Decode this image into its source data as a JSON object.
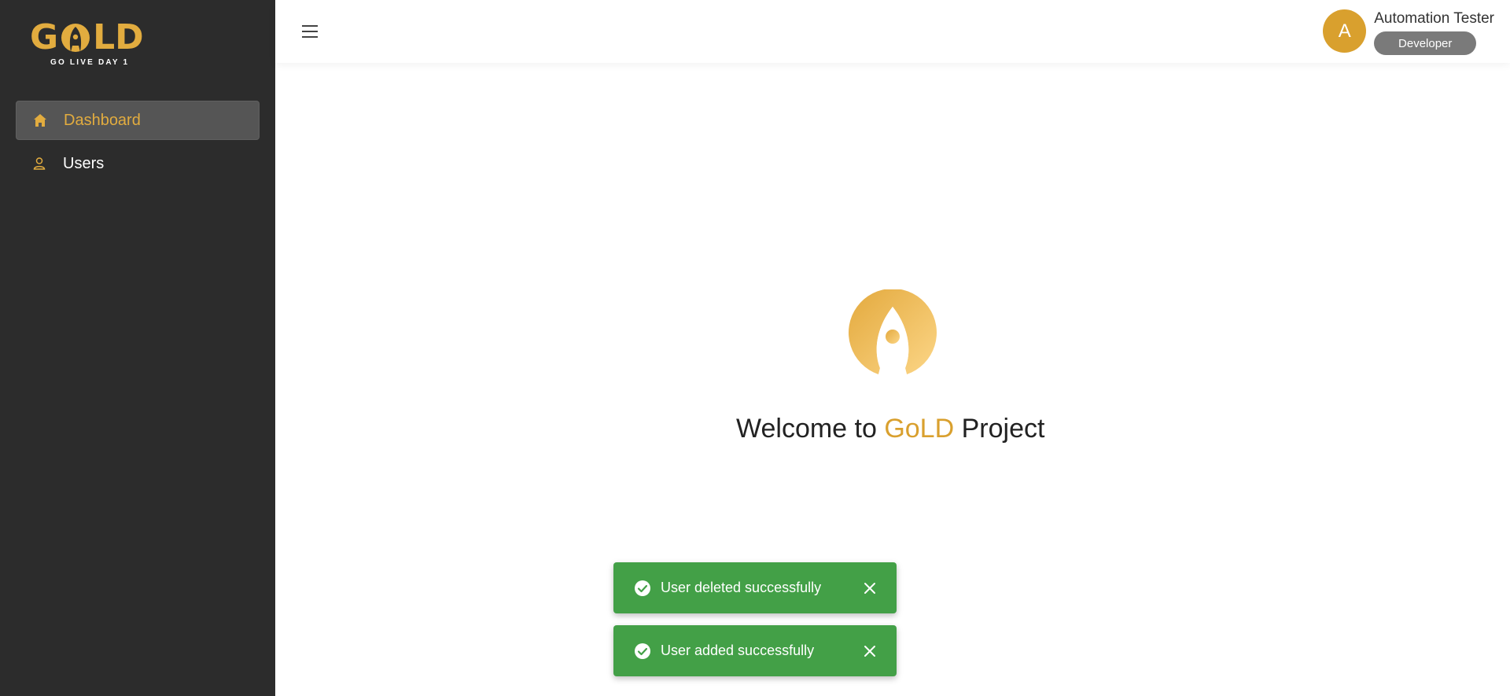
{
  "brand": {
    "logo_text_left": "G",
    "logo_text_right": "LD",
    "tagline": "GO LIVE DAY 1",
    "accent_color": "#e2ac3f"
  },
  "sidebar": {
    "items": [
      {
        "label": "Dashboard",
        "icon": "home-icon",
        "active": true
      },
      {
        "label": "Users",
        "icon": "user-icon",
        "active": false
      }
    ]
  },
  "header": {
    "menu_icon": "hamburger-menu-icon",
    "user": {
      "avatar_initial": "A",
      "name": "Automation Tester",
      "role": "Developer"
    }
  },
  "main": {
    "welcome_prefix": "Welcome to ",
    "welcome_brand": "GoLD",
    "welcome_suffix": " Project"
  },
  "toasts": [
    {
      "message": "User deleted successfully",
      "status": "success",
      "color": "#43a047"
    },
    {
      "message": "User added successfully",
      "status": "success",
      "color": "#43a047"
    }
  ]
}
